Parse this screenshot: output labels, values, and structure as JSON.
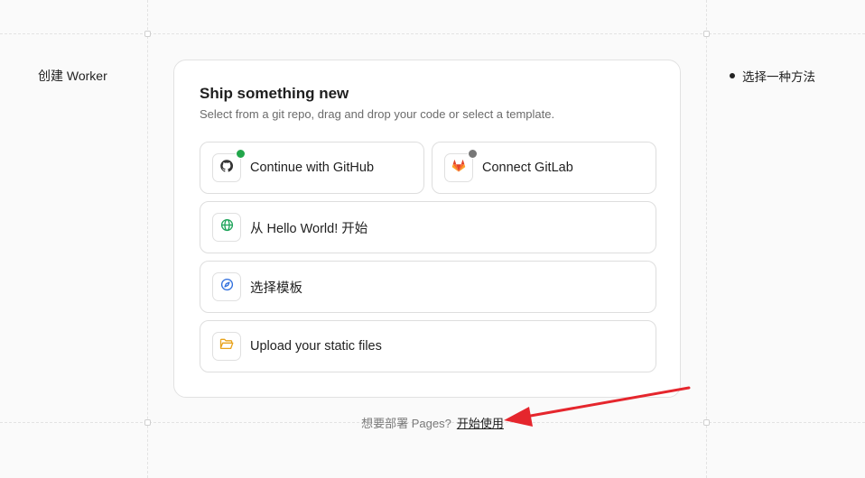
{
  "page": {
    "left_label": "创建 Worker",
    "step_label": "选择一种方法"
  },
  "card": {
    "title": "Ship something new",
    "subtitle": "Select from a git repo, drag and drop your code or select a template.",
    "options": {
      "github": {
        "label": "Continue with GitHub",
        "icon": "github-icon",
        "status_color": "#22a64b"
      },
      "gitlab": {
        "label": "Connect GitLab",
        "icon": "gitlab-icon",
        "status_color": "#777777"
      },
      "hello_world": {
        "label": "从 Hello World! 开始",
        "icon": "globe-icon"
      },
      "template": {
        "label": "选择模板",
        "icon": "compass-icon"
      },
      "upload": {
        "label": "Upload your static files",
        "icon": "folder-icon"
      }
    }
  },
  "footer": {
    "question": "想要部署 Pages?",
    "link": "开始使用"
  },
  "colors": {
    "arrow": "#e5262d",
    "globe": "#1ea45a",
    "compass": "#2f6fde",
    "folder": "#e8a21a",
    "gitlab": "#e2432a"
  }
}
